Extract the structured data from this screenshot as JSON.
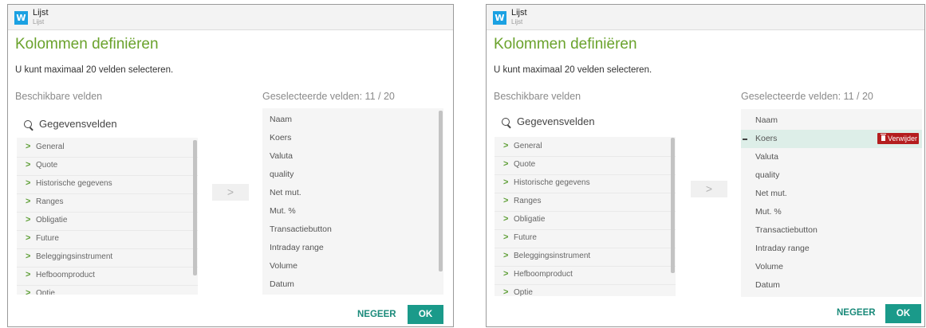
{
  "window": {
    "app_icon": "W",
    "title": "Lijst",
    "subtitle": "Lijst"
  },
  "dialog": {
    "heading": "Kolommen definiëren",
    "info": "U kunt maximaal 20 velden selecteren.",
    "available_label": "Beschikbare velden",
    "selected_label": "Geselecteerde velden: 11 / 20",
    "search_placeholder": "Gegevensvelden",
    "move_button": ">",
    "chevron": ">",
    "available_fields": [
      "General",
      "Quote",
      "Historische gegevens",
      "Ranges",
      "Obligatie",
      "Future",
      "Beleggingsinstrument",
      "Hefboomproduct",
      "Optie"
    ],
    "selected_fields": [
      "Naam",
      "Koers",
      "Valuta",
      "quality",
      "Net mut.",
      "Mut. %",
      "Transactiebutton",
      "Intraday range",
      "Volume",
      "Datum"
    ],
    "highlighted_field": "Koers",
    "remove_button": "Verwijder",
    "ignore_button": "NEGEER",
    "ok_button": "OK"
  },
  "colors": {
    "heading": "#6aa22c",
    "app_icon": "#1ba1e2",
    "ok_button": "#1a9a8a",
    "ignore_text": "#1a8a7a",
    "remove_button": "#b41e1e",
    "highlight_row": "#ddeee8"
  },
  "icons": [
    "w-app-icon",
    "search-icon",
    "chevron-right-icon",
    "dash-icon",
    "trash-icon"
  ]
}
